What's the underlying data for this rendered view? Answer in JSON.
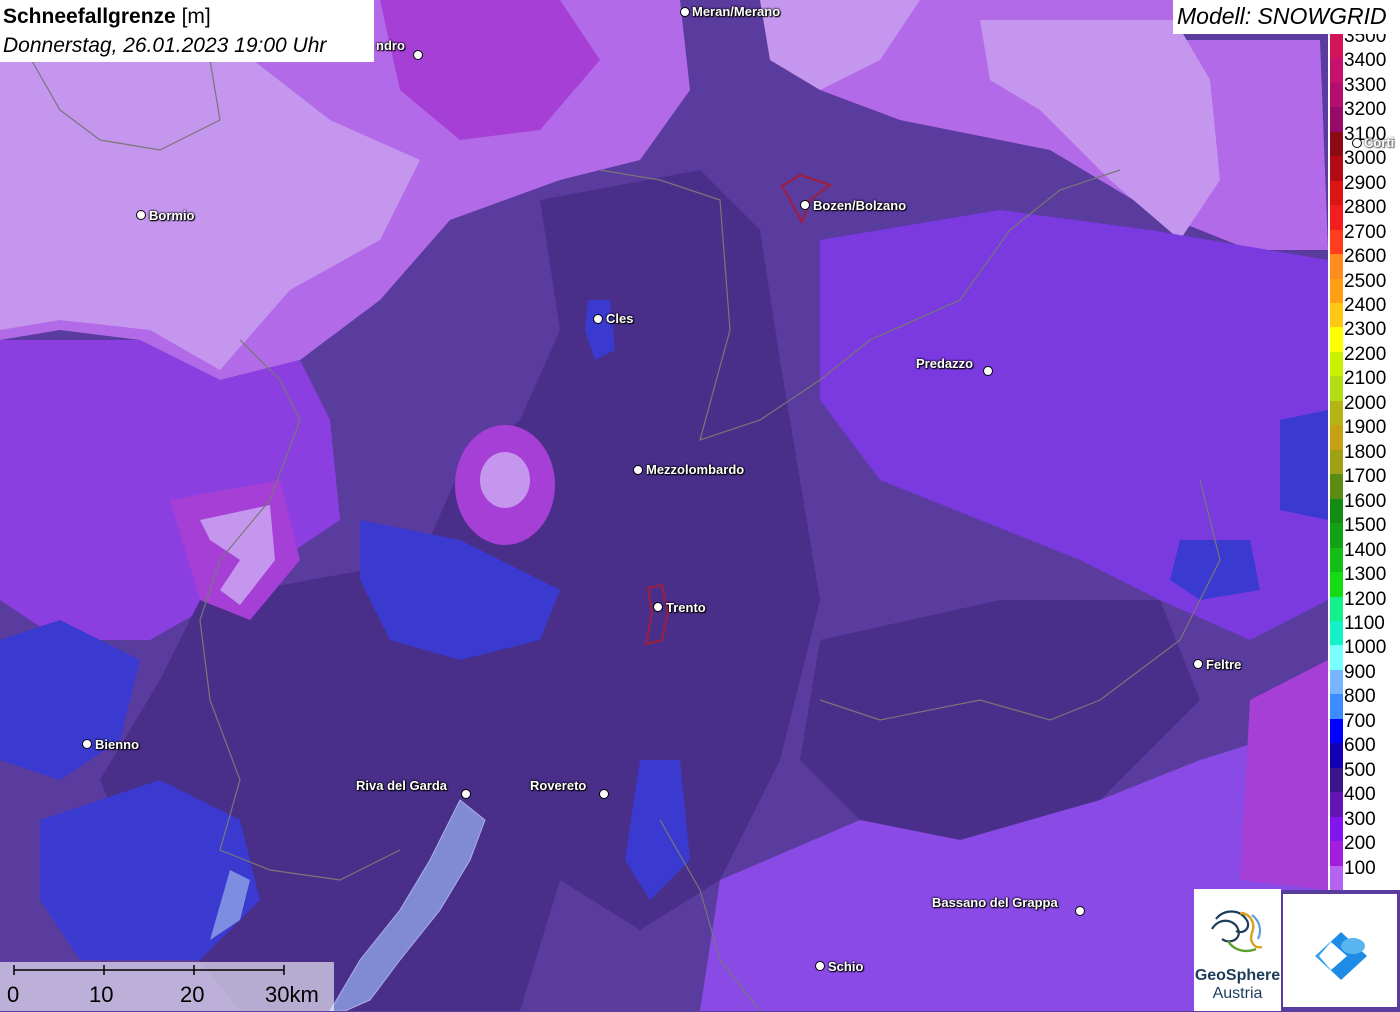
{
  "title": {
    "name": "Schneefallgrenze",
    "unit": "[m]",
    "datetime": "Donnerstag, 26.01.2023 19:00 Uhr"
  },
  "model": "Modell: SNOWGRID",
  "legend": {
    "items": [
      {
        "label": "3500",
        "color": "#d4145a"
      },
      {
        "label": "3400",
        "color": "#c8106e"
      },
      {
        "label": "3300",
        "color": "#b30e6e"
      },
      {
        "label": "3200",
        "color": "#960a6a"
      },
      {
        "label": "3100",
        "color": "#8c0a14"
      },
      {
        "label": "3000",
        "color": "#b40a14"
      },
      {
        "label": "2900",
        "color": "#dc1414"
      },
      {
        "label": "2800",
        "color": "#f01e1e"
      },
      {
        "label": "2700",
        "color": "#ff3c1e"
      },
      {
        "label": "2600",
        "color": "#ff8c1e"
      },
      {
        "label": "2500",
        "color": "#ffa014"
      },
      {
        "label": "2400",
        "color": "#ffc814"
      },
      {
        "label": "2300",
        "color": "#ffff00"
      },
      {
        "label": "2200",
        "color": "#c8f000"
      },
      {
        "label": "2100",
        "color": "#b4dc14"
      },
      {
        "label": "2000",
        "color": "#b4b414"
      },
      {
        "label": "1900",
        "color": "#c8a014"
      },
      {
        "label": "1800",
        "color": "#a0a014"
      },
      {
        "label": "1700",
        "color": "#5a8c14"
      },
      {
        "label": "1600",
        "color": "#148c14"
      },
      {
        "label": "1500",
        "color": "#14a014"
      },
      {
        "label": "1400",
        "color": "#14be14"
      },
      {
        "label": "1300",
        "color": "#14dc14"
      },
      {
        "label": "1200",
        "color": "#14f08c"
      },
      {
        "label": "1100",
        "color": "#14f0c8"
      },
      {
        "label": "1000",
        "color": "#78ffff"
      },
      {
        "label": "900",
        "color": "#78b4ff"
      },
      {
        "label": "800",
        "color": "#3c8cff"
      },
      {
        "label": "700",
        "color": "#0000ff"
      },
      {
        "label": "600",
        "color": "#1400b4"
      },
      {
        "label": "500",
        "color": "#3c148c"
      },
      {
        "label": "400",
        "color": "#6414b4"
      },
      {
        "label": "300",
        "color": "#8214f0"
      },
      {
        "label": "200",
        "color": "#a01edc"
      },
      {
        "label": "100",
        "color": "#b464f0"
      }
    ]
  },
  "cities": [
    {
      "name": "Meran/Merano"
    },
    {
      "name": "Bozen/Bolzano"
    },
    {
      "name": "Bormio"
    },
    {
      "name": "Cles"
    },
    {
      "name": "Predazzo"
    },
    {
      "name": "Mezzolombardo"
    },
    {
      "name": "Trento"
    },
    {
      "name": "Feltre"
    },
    {
      "name": "Bienno"
    },
    {
      "name": "Riva del Garda"
    },
    {
      "name": "Rovereto"
    },
    {
      "name": "Bassano del Grappa"
    },
    {
      "name": "Schio"
    },
    {
      "name": "ndro"
    },
    {
      "name": "Corti"
    }
  ],
  "scale_bar": {
    "labels": [
      "0",
      "10",
      "20",
      "30km"
    ]
  },
  "logos": {
    "geosphere_line1": "GeoSphere",
    "geosphere_line2": "Austria",
    "geosphere_icon": "geosphere-logo-icon",
    "cloud_icon": "blue-cloud-diamond-icon"
  }
}
